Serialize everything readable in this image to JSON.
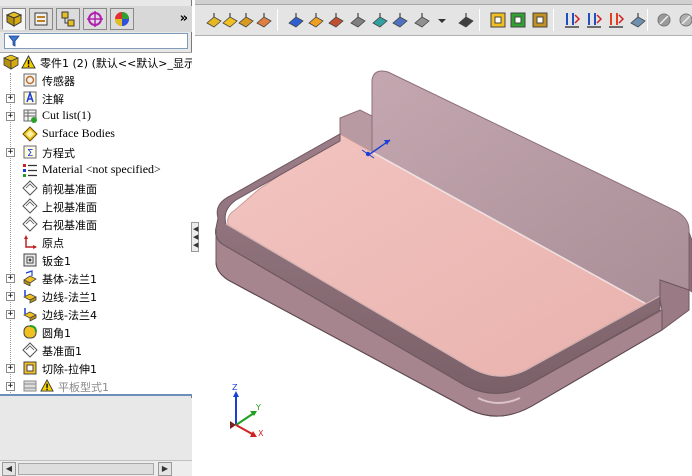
{
  "panel": {
    "tabs": [
      {
        "name": "featuremanager-tab",
        "icon": "featuremanager-icon"
      },
      {
        "name": "propertymanager-tab",
        "icon": "propertymanager-icon"
      },
      {
        "name": "configurationmanager-tab",
        "icon": "configurationmanager-icon"
      },
      {
        "name": "dimxpert-tab",
        "icon": "dimxpert-icon"
      },
      {
        "name": "display-manager-tab",
        "icon": "display-manager-icon"
      }
    ],
    "more_label": "»"
  },
  "tree": {
    "root": "零件1 (2)  (默认<<默认>_显示",
    "items": [
      {
        "label": "传感器",
        "icon": "sensor-icon",
        "expandable": false
      },
      {
        "label": "注解",
        "icon": "annotation-icon",
        "expandable": true
      },
      {
        "label": "Cut list(1)",
        "icon": "cut-list-icon",
        "expandable": true
      },
      {
        "label": "Surface Bodies",
        "icon": "surface-bodies-icon",
        "expandable": false
      },
      {
        "label": "方程式",
        "icon": "equation-icon",
        "expandable": true
      },
      {
        "label": "Material <not specified>",
        "icon": "material-icon",
        "expandable": false
      },
      {
        "label": "前视基准面",
        "icon": "plane-icon",
        "expandable": false
      },
      {
        "label": "上视基准面",
        "icon": "plane-icon",
        "expandable": false
      },
      {
        "label": "右视基准面",
        "icon": "plane-icon",
        "expandable": false
      },
      {
        "label": "原点",
        "icon": "origin-icon",
        "expandable": false
      },
      {
        "label": "钣金1",
        "icon": "sheet-metal-icon",
        "expandable": false
      },
      {
        "label": "基体-法兰1",
        "icon": "base-flange-icon",
        "expandable": true
      },
      {
        "label": "边线-法兰1",
        "icon": "edge-flange-icon",
        "expandable": true
      },
      {
        "label": "边线-法兰4",
        "icon": "edge-flange-icon",
        "expandable": true
      },
      {
        "label": "圆角1",
        "icon": "fillet-icon",
        "expandable": false
      },
      {
        "label": "基准面1",
        "icon": "plane-icon",
        "expandable": false
      },
      {
        "label": "切除-拉伸1",
        "icon": "cut-extrude-icon",
        "expandable": true
      },
      {
        "label": "平板型式1",
        "icon": "flat-pattern-icon",
        "expandable": true,
        "suppressed": true
      }
    ]
  },
  "toolbar": {
    "icons": [
      "sheet-metal-icon",
      "base-flange-icon",
      "convert-to-sheet-metal-icon",
      "lofted-bend-icon",
      "edge-flange-icon",
      "miter-flange-icon",
      "hem-icon",
      "jog-icon",
      "sketched-bend-icon",
      "cross-break-icon",
      "closed-corner-icon",
      "corner-dropdown-icon",
      "forming-tool-icon",
      "extruded-cut-icon",
      "simple-hole-icon",
      "vent-icon",
      "unfold-icon",
      "fold-icon",
      "flatten-icon",
      "no-bends-icon",
      "rip-icon",
      "insert-bends-icon"
    ]
  },
  "triad": {
    "x_label": "X",
    "y_label": "Y",
    "z_label": "Z"
  },
  "colors": {
    "model_floor": "#eebcb8",
    "model_wall": "#b99aa3",
    "model_edge": "#8d6f78",
    "accent_blue": "#1a3fd6",
    "tree_bg": "#ffffff",
    "panel_bg": "#e8e8e8"
  }
}
